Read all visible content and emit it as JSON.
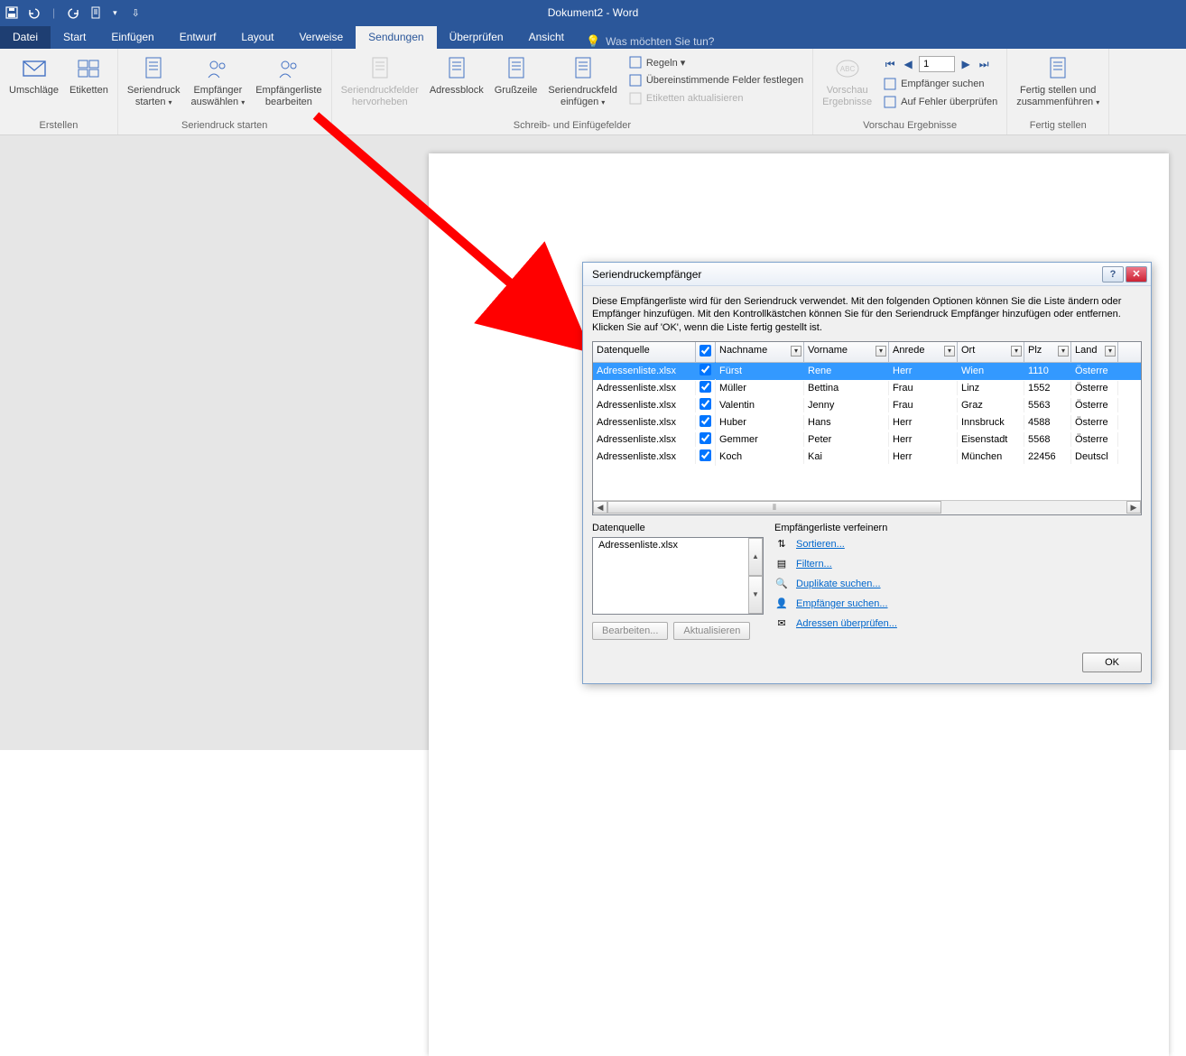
{
  "app_title": "Dokument2 - Word",
  "tabs": {
    "file": "Datei",
    "items": [
      "Start",
      "Einfügen",
      "Entwurf",
      "Layout",
      "Verweise",
      "Sendungen",
      "Überprüfen",
      "Ansicht"
    ],
    "active_index": 5,
    "tell_me": "Was möchten Sie tun?"
  },
  "ribbon": {
    "groups": [
      {
        "label": "Erstellen",
        "buttons": [
          {
            "lbl": "Umschläge"
          },
          {
            "lbl": "Etiketten"
          }
        ]
      },
      {
        "label": "Seriendruck starten",
        "buttons": [
          {
            "lbl": "Seriendruck\nstarten",
            "dd": true
          },
          {
            "lbl": "Empfänger\nauswählen",
            "dd": true
          },
          {
            "lbl": "Empfängerliste\nbearbeiten"
          }
        ]
      },
      {
        "label": "Schreib- und Einfügefelder",
        "buttons": [
          {
            "lbl": "Seriendruckfelder\nhervorheben",
            "disabled": true
          },
          {
            "lbl": "Adressblock"
          },
          {
            "lbl": "Grußzeile"
          },
          {
            "lbl": "Seriendruckfeld\neinfügen",
            "dd": true
          }
        ],
        "side": [
          {
            "lbl": "Regeln",
            "dd": true
          },
          {
            "lbl": "Übereinstimmende Felder festlegen"
          },
          {
            "lbl": "Etiketten aktualisieren",
            "disabled": true
          }
        ]
      },
      {
        "label": "Vorschau Ergebnisse",
        "nav_value": "1",
        "buttons": [
          {
            "lbl": "Vorschau\nErgebnisse",
            "disabled": true
          }
        ],
        "side": [
          {
            "lbl": "Empfänger suchen"
          },
          {
            "lbl": "Auf Fehler überprüfen"
          }
        ]
      },
      {
        "label": "Fertig stellen",
        "buttons": [
          {
            "lbl": "Fertig stellen und\nzusammenführen",
            "dd": true
          }
        ]
      }
    ]
  },
  "dialog": {
    "title": "Seriendruckempfänger",
    "description": "Diese Empfängerliste wird für den Seriendruck verwendet. Mit den folgenden Optionen können Sie die Liste ändern oder Empfänger hinzufügen. Mit den Kontrollkästchen können Sie für den Seriendruck Empfänger hinzufügen oder entfernen. Klicken Sie auf 'OK', wenn die Liste fertig gestellt ist.",
    "columns": [
      "Datenquelle",
      "",
      "Nachname",
      "Vorname",
      "Anrede",
      "Ort",
      "Plz",
      "Land"
    ],
    "rows": [
      {
        "ds": "Adressenliste.xlsx",
        "chk": true,
        "nachname": "Fürst",
        "vorname": "Rene",
        "anrede": "Herr",
        "ort": "Wien",
        "plz": "1110",
        "land": "Österre",
        "sel": true
      },
      {
        "ds": "Adressenliste.xlsx",
        "chk": true,
        "nachname": "Müller",
        "vorname": "Bettina",
        "anrede": "Frau",
        "ort": "Linz",
        "plz": "1552",
        "land": "Österre"
      },
      {
        "ds": "Adressenliste.xlsx",
        "chk": true,
        "nachname": "Valentin",
        "vorname": "Jenny",
        "anrede": "Frau",
        "ort": "Graz",
        "plz": "5563",
        "land": "Österre"
      },
      {
        "ds": "Adressenliste.xlsx",
        "chk": true,
        "nachname": "Huber",
        "vorname": "Hans",
        "anrede": "Herr",
        "ort": "Innsbruck",
        "plz": "4588",
        "land": "Österre"
      },
      {
        "ds": "Adressenliste.xlsx",
        "chk": true,
        "nachname": "Gemmer",
        "vorname": "Peter",
        "anrede": "Herr",
        "ort": "Eisenstadt",
        "plz": "5568",
        "land": "Österre"
      },
      {
        "ds": "Adressenliste.xlsx",
        "chk": true,
        "nachname": "Koch",
        "vorname": "Kai",
        "anrede": "Herr",
        "ort": "München",
        "plz": "22456",
        "land": "Deutscl"
      }
    ],
    "datasource_label": "Datenquelle",
    "datasource_item": "Adressenliste.xlsx",
    "refine_label": "Empfängerliste verfeinern",
    "refine_links": [
      "Sortieren...",
      "Filtern...",
      "Duplikate suchen...",
      "Empfänger suchen...",
      "Adressen überprüfen..."
    ],
    "edit_btn": "Bearbeiten...",
    "refresh_btn": "Aktualisieren",
    "ok_btn": "OK"
  }
}
